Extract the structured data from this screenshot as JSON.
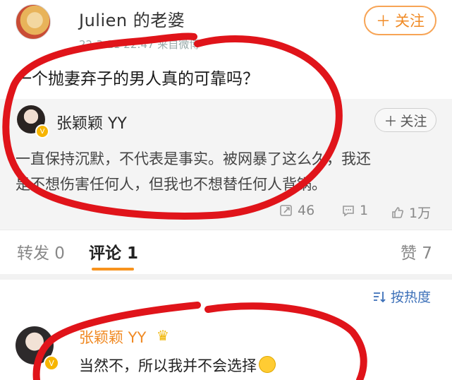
{
  "post": {
    "username": "Julien 的老婆",
    "meta": "22-3-11 22:47 来自微博",
    "follow_label": "关注",
    "text": "一个抛妻弃子的男人真的可靠吗？"
  },
  "quoted": {
    "name": "张颖颖 YY",
    "follow_label": "关注",
    "text_line1": "一直保持沉默，不代表是事实。被网暴了这么久，我还",
    "text_line2": "是不想伤害任何人，但我也不想替任何人背锅。",
    "reposts": "46",
    "comments": "1",
    "likes": "1万"
  },
  "tabs": {
    "repost_label": "转发 0",
    "comment_label": "评论 1",
    "like_label": "赞 7"
  },
  "sort_label": "按热度",
  "comment": {
    "name": "张颖颖 YY",
    "text": "当然不，所以我并不会选择"
  },
  "colors": {
    "accent": "#f08a24",
    "link_blue": "#3b6fb8",
    "annotation_red": "#e0141a"
  }
}
